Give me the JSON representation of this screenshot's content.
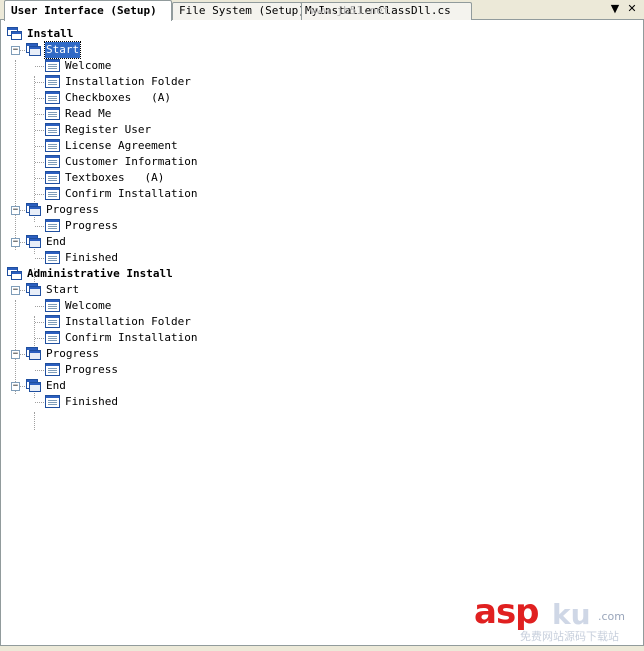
{
  "tabs": [
    {
      "label": "User Interface (Setup)",
      "active": true
    },
    {
      "label": "File System (Setup)",
      "active": false
    },
    {
      "label": "MyInstallerClassDll.cs",
      "active": false
    }
  ],
  "toolbar": {
    "dropdown_glyph": "▼",
    "close_glyph": "✕"
  },
  "watermark": {
    "top_text": "www.jb51.net",
    "brand": "asp",
    "brand_ku": "ku",
    "brand_com": ".com",
    "sub": "免费网站源码下载站"
  },
  "tree": {
    "install": {
      "label": "Install",
      "start": {
        "label": "Start",
        "dialogs": [
          "Welcome",
          "Installation Folder",
          "Checkboxes   (A)",
          "Read Me",
          "Register User",
          "License Agreement",
          "Customer Information",
          "Textboxes   (A)",
          "Confirm Installation"
        ]
      },
      "progress": {
        "label": "Progress",
        "dialogs": [
          "Progress"
        ]
      },
      "end": {
        "label": "End",
        "dialogs": [
          "Finished"
        ]
      }
    },
    "admin": {
      "label": "Administrative Install",
      "start": {
        "label": "Start",
        "dialogs": [
          "Welcome",
          "Installation Folder",
          "Confirm Installation"
        ]
      },
      "progress": {
        "label": "Progress",
        "dialogs": [
          "Progress"
        ]
      },
      "end": {
        "label": "End",
        "dialogs": [
          "Finished"
        ]
      }
    }
  }
}
